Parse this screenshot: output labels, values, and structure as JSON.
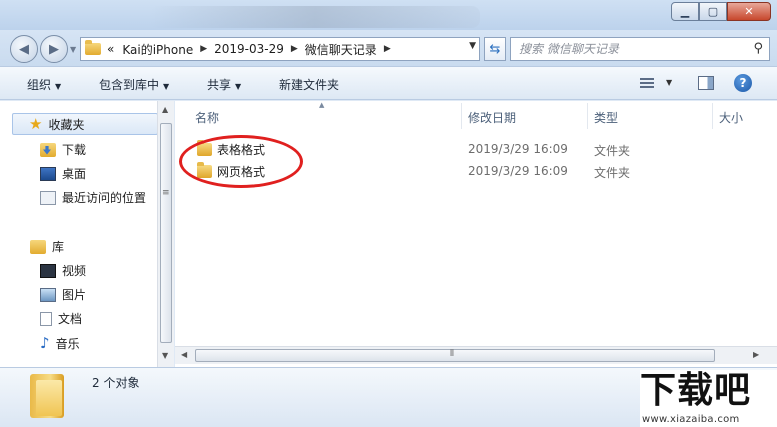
{
  "breadcrumb": {
    "overflow": "«",
    "items": [
      "Kai的iPhone",
      "2019-03-29",
      "微信聊天记录"
    ]
  },
  "search": {
    "placeholder": "搜索 微信聊天记录"
  },
  "toolbar": {
    "organize": "组织",
    "include_in_library": "包含到库中",
    "share": "共享",
    "new_folder": "新建文件夹"
  },
  "nav_pane": {
    "favorites": "收藏夹",
    "downloads": "下载",
    "desktop": "桌面",
    "recent_places": "最近访问的位置",
    "libraries": "库",
    "videos": "视频",
    "pictures": "图片",
    "documents": "文档",
    "music": "音乐"
  },
  "columns": {
    "name": "名称",
    "date_modified": "修改日期",
    "type": "类型",
    "size": "大小"
  },
  "files": [
    {
      "name": "表格格式",
      "date": "2019/3/29 16:09",
      "type": "文件夹"
    },
    {
      "name": "网页格式",
      "date": "2019/3/29 16:09",
      "type": "文件夹"
    }
  ],
  "status": {
    "object_count": "2 个对象"
  },
  "watermark": {
    "logo": "下载吧",
    "url": "www.xiazaiba.com"
  },
  "colors": {
    "highlight_ellipse": "#e0201f",
    "window_chrome": "#c9dbef"
  }
}
